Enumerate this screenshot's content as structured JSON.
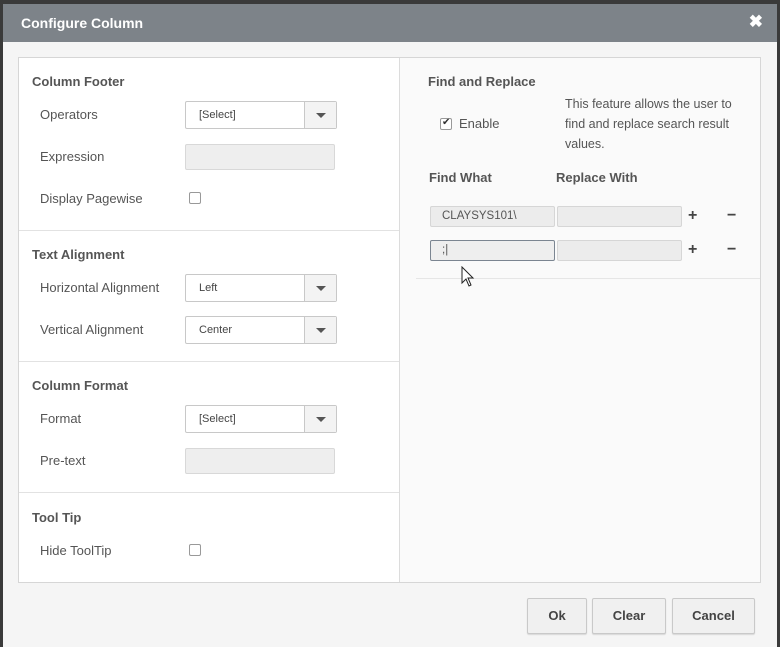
{
  "dialog": {
    "title": "Configure Column",
    "close_glyph": "✖"
  },
  "column_footer": {
    "title": "Column Footer",
    "operators_label": "Operators",
    "operators_value": "[Select]",
    "expression_label": "Expression",
    "expression_value": "",
    "display_pagewise_label": "Display Pagewise",
    "display_pagewise_checked": false
  },
  "text_alignment": {
    "title": "Text Alignment",
    "horizontal_label": "Horizontal Alignment",
    "horizontal_value": "Left",
    "vertical_label": "Vertical Alignment",
    "vertical_value": "Center"
  },
  "column_format": {
    "title": "Column Format",
    "format_label": "Format",
    "format_value": "[Select]",
    "pretext_label": "Pre-text",
    "pretext_value": ""
  },
  "tool_tip": {
    "title": "Tool Tip",
    "hide_label": "Hide ToolTip",
    "hide_checked": false
  },
  "find_replace": {
    "title": "Find and Replace",
    "enable_label": "Enable",
    "enable_checked": true,
    "description": "This feature allows the user to find and replace search result values.",
    "find_header": "Find What",
    "replace_header": "Replace With",
    "rows": [
      {
        "find": "CLAYSYS101\\",
        "replace": ""
      },
      {
        "find": ";|",
        "replace": ""
      }
    ],
    "plus_glyph": "+",
    "minus_glyph": "−"
  },
  "buttons": {
    "ok": "Ok",
    "clear": "Clear",
    "cancel": "Cancel"
  },
  "colors": {
    "titlebar": "#7d8389",
    "panel": "#ffffff",
    "dialog_bg": "#f5f5f5"
  }
}
